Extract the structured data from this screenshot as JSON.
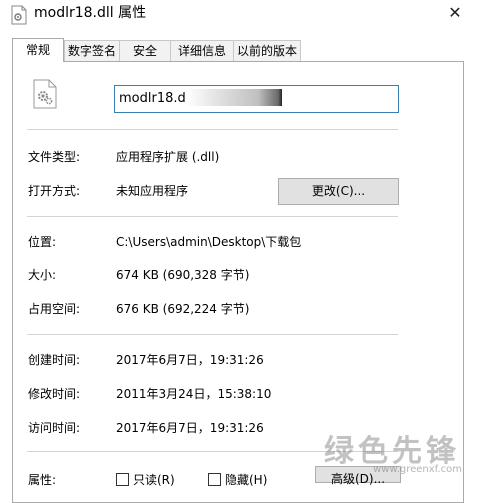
{
  "window": {
    "title": "modlr18.dll 属性",
    "close_glyph": "✕"
  },
  "tabs": [
    {
      "label": "常规",
      "active": true
    },
    {
      "label": "数字签名",
      "active": false
    },
    {
      "label": "安全",
      "active": false
    },
    {
      "label": "详细信息",
      "active": false
    },
    {
      "label": "以前的版本",
      "active": false
    }
  ],
  "general": {
    "file_name": "modlr18.dll",
    "file_type": {
      "label": "文件类型:",
      "value": "应用程序扩展 (.dll)"
    },
    "opens_with": {
      "label": "打开方式:",
      "value": "未知应用程序",
      "button": "更改(C)..."
    },
    "location": {
      "label": "位置:",
      "value": "C:\\Users\\admin\\Desktop\\下载包"
    },
    "size": {
      "label": "大小:",
      "value": "674 KB (690,328 字节)"
    },
    "size_on_disk": {
      "label": "占用空间:",
      "value": "676 KB (692,224 字节)"
    },
    "created": {
      "label": "创建时间:",
      "value": "2017年6月7日，19:31:26"
    },
    "modified": {
      "label": "修改时间:",
      "value": "2011年3月24日，15:38:10"
    },
    "accessed": {
      "label": "访问时间:",
      "value": "2017年6月7日，19:31:26"
    },
    "attributes": {
      "label": "属性:",
      "readonly": {
        "label": "只读(R)",
        "checked": false
      },
      "hidden": {
        "label": "隐藏(H)",
        "checked": false
      },
      "advanced_button": "高级(D)..."
    }
  },
  "watermark": {
    "text": "绿色先锋",
    "url": "www.greenxf.com"
  },
  "icons": {
    "title": "dll-file-icon",
    "file": "dll-file-gear-icon"
  },
  "colors": {
    "accent_border": "#3c7fb1",
    "button_bg": "#e1e1e1"
  }
}
